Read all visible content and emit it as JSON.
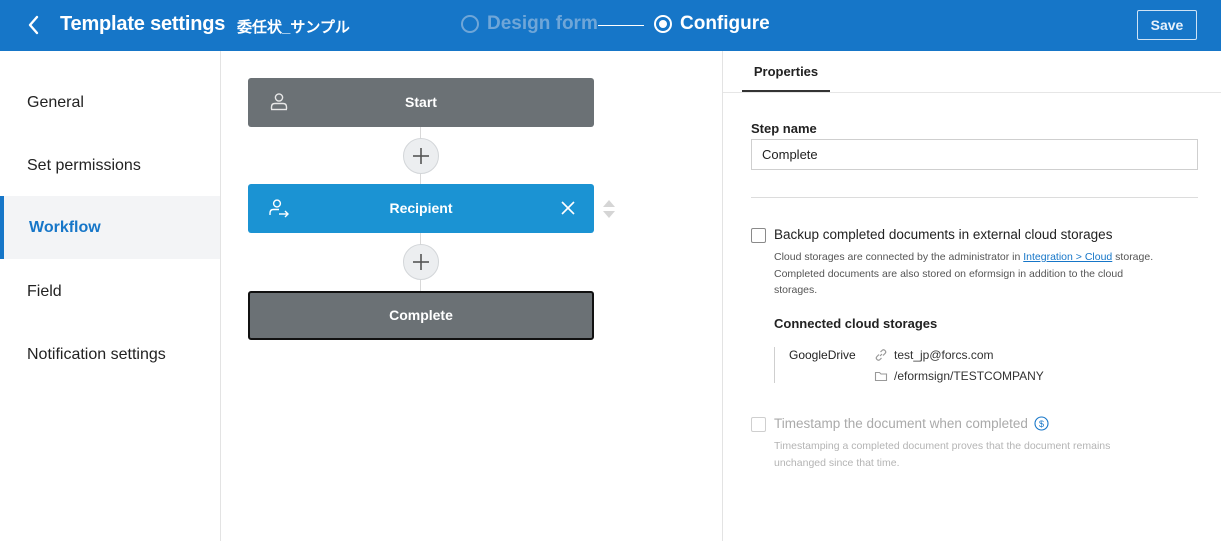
{
  "header": {
    "title": "Template settings",
    "document_name": "委任状_サンプル",
    "steps": [
      {
        "label": "Design form",
        "active": false
      },
      {
        "label": "Configure",
        "active": true
      }
    ],
    "save_label": "Save",
    "colors": {
      "bar": "#1676c8",
      "inactive_step": "#6fa6d8"
    }
  },
  "sidebar": {
    "items": [
      {
        "label": "General"
      },
      {
        "label": "Set permissions"
      },
      {
        "label": "Workflow",
        "active": true
      },
      {
        "label": "Field"
      },
      {
        "label": "Notification settings"
      }
    ]
  },
  "workflow": {
    "nodes": [
      {
        "label": "Start",
        "icon": "person-icon"
      },
      {
        "label": "Recipient",
        "icon": "person-forward-icon"
      },
      {
        "label": "Complete",
        "selected": true
      }
    ],
    "colors": {
      "node_gray": "#6b7175",
      "node_blue": "#1b93d3"
    }
  },
  "properties": {
    "tab_label": "Properties",
    "step_name_label": "Step name",
    "step_name_value": "Complete",
    "backup": {
      "label": "Backup completed documents in external cloud storages",
      "checked": false,
      "desc_before_link": "Cloud storages are connected by the administrator in ",
      "link_text": "Integration > Cloud",
      "desc_after_link": " storage.",
      "desc_line2": "Completed documents are also stored on eformsign in addition to the cloud",
      "desc_line3": "storages."
    },
    "connected_heading": "Connected cloud storages",
    "cloud": {
      "name": "GoogleDrive",
      "account": "test_jp@forcs.com",
      "path": "/eformsign/TESTCOMPANY"
    },
    "timestamp": {
      "label": "Timestamp the document when completed",
      "checked": false,
      "disabled": true,
      "desc_line1": "Timestamping a completed document proves that the document remains",
      "desc_line2": "unchanged since that time."
    }
  }
}
